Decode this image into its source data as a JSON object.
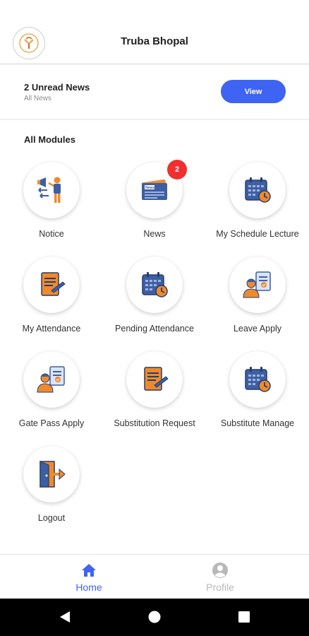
{
  "header": {
    "title": "Truba Bhopal",
    "logo_icon": "truba-logo-icon"
  },
  "news_bar": {
    "title": "2 Unread News",
    "subtitle": "All News",
    "button_label": "View"
  },
  "modules_section": {
    "title": "All Modules",
    "items": [
      {
        "label": "Notice",
        "icon": "megaphone-presenter-icon"
      },
      {
        "label": "News",
        "icon": "newspaper-icon",
        "badge": "2"
      },
      {
        "label": "My Schedule Lecture",
        "icon": "calendar-clock-icon"
      },
      {
        "label": "My Attendance",
        "icon": "document-pen-icon"
      },
      {
        "label": "Pending Attendance",
        "icon": "calendar-clock-icon"
      },
      {
        "label": "Leave Apply",
        "icon": "person-clipboard-icon"
      },
      {
        "label": "Gate Pass Apply",
        "icon": "person-clipboard-icon"
      },
      {
        "label": "Substitution Request",
        "icon": "document-pen-icon"
      },
      {
        "label": "Substitute Manage",
        "icon": "calendar-clock-icon"
      },
      {
        "label": "Logout",
        "icon": "door-exit-icon"
      }
    ]
  },
  "bottom_nav": {
    "items": [
      {
        "label": "Home",
        "icon": "home-icon",
        "active": true
      },
      {
        "label": "Profile",
        "icon": "profile-icon",
        "active": false
      }
    ]
  },
  "colors": {
    "accent": "#3f63f3",
    "badge": "#f0302f",
    "inactive": "#b8b8b8",
    "icon_blue": "#3d5fa3",
    "icon_orange": "#ef8a2c"
  },
  "system_nav": {
    "back_icon": "back-triangle-icon",
    "home_icon": "home-circle-icon",
    "recents_icon": "recents-square-icon"
  }
}
